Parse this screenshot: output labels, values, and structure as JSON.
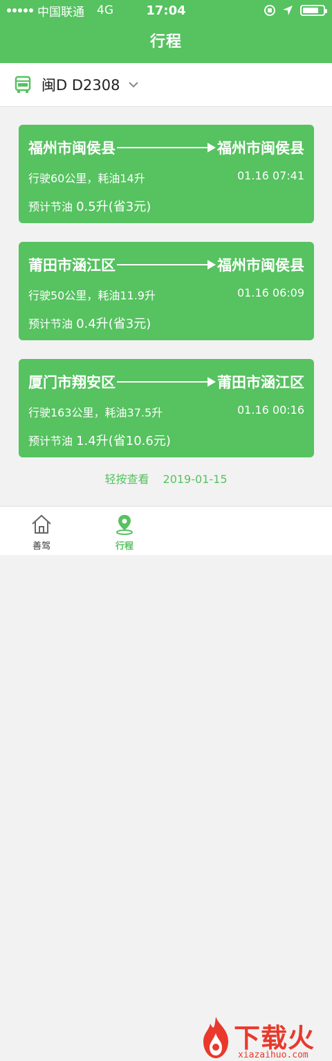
{
  "status_bar": {
    "carrier": "中国联通",
    "network": "4G",
    "time": "17:04"
  },
  "header": {
    "title": "行程"
  },
  "vehicle": {
    "plate": "闽D D2308"
  },
  "trips": [
    {
      "from": "福州市闽侯县",
      "to": "福州市闽侯县",
      "detail": "行驶60公里，耗油14升",
      "time": "01.16 07:41",
      "saving_label": "预计节油",
      "saving_value": "0.5升(省3元)"
    },
    {
      "from": "莆田市涵江区",
      "to": "福州市闽侯县",
      "detail": "行驶50公里，耗油11.9升",
      "time": "01.16 06:09",
      "saving_label": "预计节油",
      "saving_value": "0.4升(省3元)"
    },
    {
      "from": "厦门市翔安区",
      "to": "莆田市涵江区",
      "detail": "行驶163公里，耗油37.5升",
      "time": "01.16 00:16",
      "saving_label": "预计节油",
      "saving_value": "1.4升(省10.6元)"
    }
  ],
  "footer_hint": {
    "label": "轻按查看",
    "date": "2019-01-15"
  },
  "tabbar": {
    "items": [
      {
        "label": "善驾",
        "icon": "home-icon"
      },
      {
        "label": "行程",
        "icon": "location-pin-icon"
      }
    ]
  },
  "watermark": {
    "text": "下载火",
    "sub": "xiazaihuo.com"
  },
  "colors": {
    "primary": "#56c260",
    "watermark": "#e8392c"
  }
}
